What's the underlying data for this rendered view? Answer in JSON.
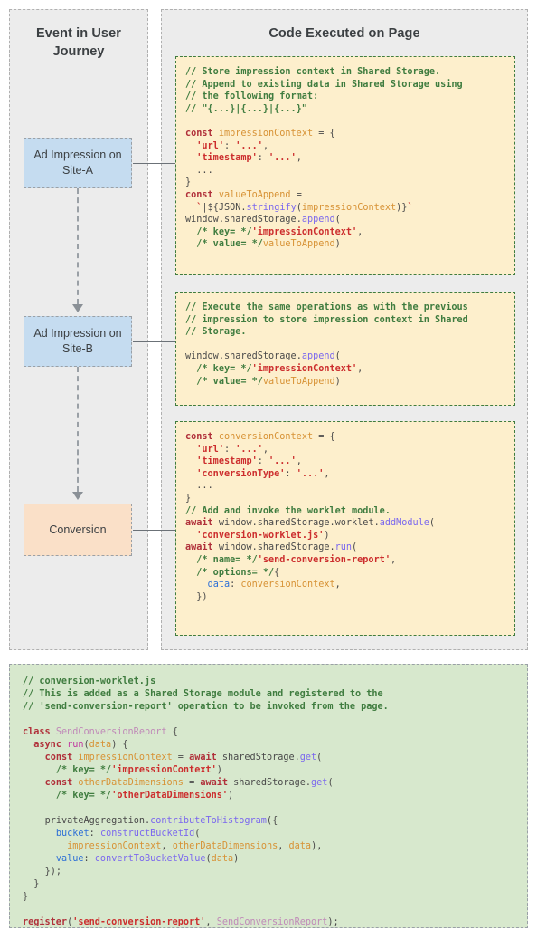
{
  "panels": {
    "left": {
      "title": "Event in User Journey"
    },
    "right": {
      "title": "Code Executed on Page"
    }
  },
  "journey_nodes": [
    {
      "id": "ad-impression-site-a",
      "label": "Ad Impression on Site-A",
      "color": "#c5dcf0"
    },
    {
      "id": "ad-impression-site-b",
      "label": "Ad Impression on Site-B",
      "color": "#c5dcf0"
    },
    {
      "id": "conversion",
      "label": "Conversion",
      "color": "#fae0c8"
    }
  ],
  "code_blocks": {
    "impression_a": {
      "background": "#fdefcc",
      "border": "#3f7c3f",
      "text": "// Store impression context in Shared Storage.\n// Append to existing data in Shared Storage using\n// the following format:\n// \"{...}|{...}|{...}\"\n\nconst impressionContext = {\n  'url': '...',\n  'timestamp': '...',\n  ...\n}\nconst valueToAppend =\n  `|${JSON.stringify(impressionContext)}`\nwindow.sharedStorage.append(\n  /* key= */'impressionContext',\n  /* value= */valueToAppend)"
    },
    "impression_b": {
      "background": "#fdefcc",
      "border": "#3f7c3f",
      "text": "// Execute the same operations as with the previous\n// impression to store impression context in Shared\n// Storage.\n\nwindow.sharedStorage.append(\n  /* key= */'impressionContext',\n  /* value= */valueToAppend)"
    },
    "conversion": {
      "background": "#fdefcc",
      "border": "#3f7c3f",
      "text": "const conversionContext = {\n  'url': '...',\n  'timestamp': '...',\n  'conversionType': '...',\n  ...\n}\n// Add and invoke the worklet module.\nawait window.sharedStorage.worklet.addModule(\n  'conversion-worklet.js')\nawait window.sharedStorage.run(\n  /* name= */'send-conversion-report',\n  /* options= */{\n    data: conversionContext,\n  })"
    },
    "worklet": {
      "background": "#d7e8cd",
      "border": "#9aa0a6",
      "text": "// conversion-worklet.js\n// This is added as a Shared Storage module and registered to the\n// 'send-conversion-report' operation to be invoked from the page.\n\nclass SendConversionReport {\n  async run(data) {\n    const impressionContext = await sharedStorage.get(\n      /* key= */'impressionContext')\n    const otherDataDimensions = await sharedStorage.get(\n      /* key= */'otherDataDimensions')\n\n    privateAggregation.contributeToHistogram({\n      bucket: constructBucketId(\n        impressionContext, otherDataDimensions, data),\n      value: convertToBucketValue(data)\n    });\n  }\n}\n\nregister('send-conversion-report', SendConversionReport);"
    }
  },
  "colors": {
    "panel_background": "#ececec",
    "panel_border": "#b0b0b0",
    "arrow": "#6b7177",
    "comment": "#3f7c3f",
    "keyword": "#b0303a",
    "string": "#cc2d2d",
    "identifier": "#d79235",
    "method": "#7b68ee",
    "property": "#2d6fd6"
  }
}
